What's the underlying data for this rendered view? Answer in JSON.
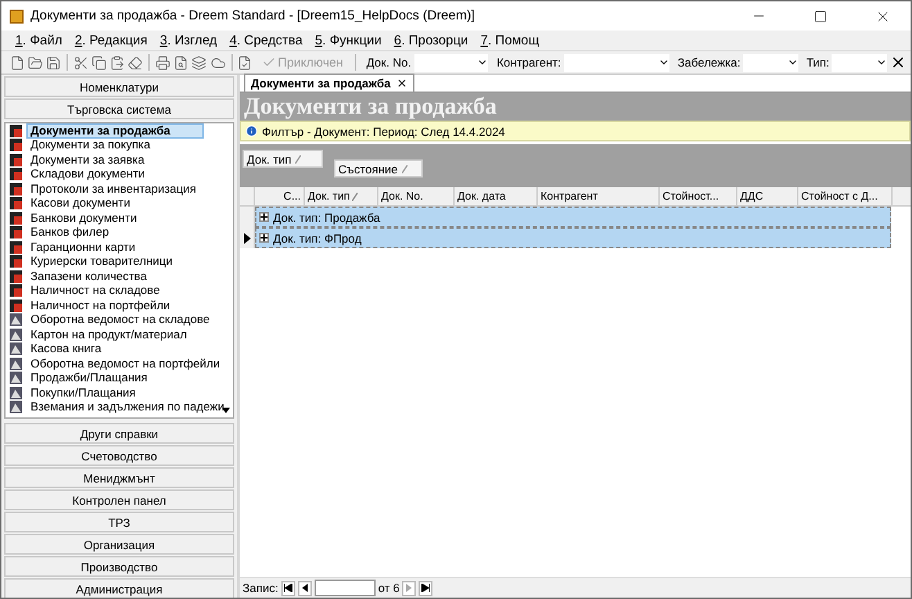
{
  "window": {
    "title": "Документи за продажба - Dreem Standard - [Dreem15_HelpDocs (Dreem)]"
  },
  "menu": [
    {
      "label": "1. Файл"
    },
    {
      "label": "2. Редакция"
    },
    {
      "label": "3. Изглед"
    },
    {
      "label": "4. Средства"
    },
    {
      "label": "5. Функции"
    },
    {
      "label": "6. Прозорци"
    },
    {
      "label": "7. Помощ"
    }
  ],
  "toolbar": {
    "action": {
      "label": "Приключен",
      "disabled": true
    },
    "filters": [
      {
        "label": "Док. No."
      },
      {
        "label": "Контрагент:"
      },
      {
        "label": "Забележка:"
      },
      {
        "label": "Тип:"
      }
    ]
  },
  "sidebar": {
    "sections_top": [
      "Номенклатури",
      "Търговска система"
    ],
    "items": [
      {
        "label": "Документи за продажба",
        "kind": "document",
        "selected": true
      },
      {
        "label": "Документи за покупка",
        "kind": "document",
        "selected": false
      },
      {
        "label": "Документи за заявка",
        "kind": "document",
        "selected": false
      },
      {
        "label": "Складови документи",
        "kind": "document",
        "selected": false
      },
      {
        "label": "Протоколи за инвентаризация",
        "kind": "document",
        "selected": false
      },
      {
        "label": "Касови документи",
        "kind": "document",
        "selected": false
      },
      {
        "label": "Банкови документи",
        "kind": "document",
        "selected": false
      },
      {
        "label": "Банков филер",
        "kind": "document",
        "selected": false
      },
      {
        "label": "Гаранционни карти",
        "kind": "document",
        "selected": false
      },
      {
        "label": "Куриерски товарителници",
        "kind": "document",
        "selected": false
      },
      {
        "label": "Запазени количества",
        "kind": "document",
        "selected": false
      },
      {
        "label": "Наличност на складове",
        "kind": "document",
        "selected": false
      },
      {
        "label": "Наличност на портфейли",
        "kind": "document",
        "selected": false
      },
      {
        "label": "Оборотна ведомост на складове",
        "kind": "report",
        "selected": false
      },
      {
        "label": "Картон на продукт/материал",
        "kind": "report",
        "selected": false
      },
      {
        "label": "Касова книга",
        "kind": "report",
        "selected": false
      },
      {
        "label": "Оборотна ведомост на портфейли",
        "kind": "report",
        "selected": false
      },
      {
        "label": "Продажби/Плащания",
        "kind": "report",
        "selected": false
      },
      {
        "label": "Покупки/Плащания",
        "kind": "report",
        "selected": false
      },
      {
        "label": "Вземания и задължения по падежи",
        "kind": "report",
        "selected": false
      }
    ],
    "sections_bottom": [
      "Други справки",
      "Счетоводство",
      "Мениджмънт",
      "Контролен панел",
      "ТРЗ",
      "Организация",
      "Производство",
      "Администрация"
    ]
  },
  "tab": {
    "label": "Документи за продажба"
  },
  "document": {
    "heading": "Документи за продажба",
    "filter": "Филтър - Документ: Период: След 14.4.2024",
    "group_by": [
      "Док. тип",
      "Състояние"
    ],
    "columns": [
      {
        "label": "С...",
        "sorted": false
      },
      {
        "label": "Док. тип",
        "sorted": true
      },
      {
        "label": "Док. No.",
        "sorted": false
      },
      {
        "label": "Док. дата",
        "sorted": false
      },
      {
        "label": "Контрагент",
        "sorted": false
      },
      {
        "label": "Стойност...",
        "sorted": false
      },
      {
        "label": "ДДС",
        "sorted": false
      },
      {
        "label": "Стойност с Д...",
        "sorted": false
      }
    ],
    "rows": [
      {
        "label": "Док. тип: Продажба",
        "current": false,
        "expanded": false
      },
      {
        "label": "Док. тип: ФПрод",
        "current": true,
        "expanded": false
      }
    ],
    "pager": {
      "label": "Запис:",
      "total": "от 6"
    }
  }
}
